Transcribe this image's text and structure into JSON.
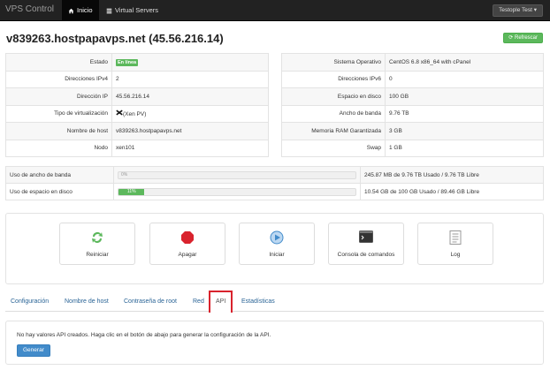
{
  "navbar": {
    "brand": "VPS Control",
    "items": [
      {
        "label": "Inicio",
        "icon": "home-icon"
      },
      {
        "label": "Virtual Servers",
        "icon": "list-icon"
      }
    ],
    "user_label": "Testople Test ▾"
  },
  "header": {
    "title": "v839263.hostpapavps.net (45.56.216.14)",
    "refresh_label": "Refrescar"
  },
  "info_left": [
    {
      "label": "Estado",
      "value": "En línea"
    },
    {
      "label": "Direcciones IPv4",
      "value": "2"
    },
    {
      "label": "Dirección IP",
      "value": "45.56.216.14"
    },
    {
      "label": "Tipo de virtualización",
      "value": "(Xen PV)"
    },
    {
      "label": "Nombre de host",
      "value": "v839263.hostpapavps.net"
    },
    {
      "label": "Nodo",
      "value": "xen101"
    }
  ],
  "info_right": [
    {
      "label": "Sistema Operativo",
      "value": "CentOS 6.8 x86_64 with cPanel"
    },
    {
      "label": "Direcciones IPv6",
      "value": "0"
    },
    {
      "label": "Espacio en disco",
      "value": "100 GB"
    },
    {
      "label": "Ancho de banda",
      "value": "9.76 TB"
    },
    {
      "label": "Memoria RAM Garantizada",
      "value": "3 GB"
    },
    {
      "label": "Swap",
      "value": "1 GB"
    }
  ],
  "usage": [
    {
      "label": "Uso de ancho de banda",
      "percent": 0,
      "bar_text": "0%",
      "detail": "245.87 MB de 9.76 TB Usado / 9.76 TB Libre"
    },
    {
      "label": "Uso de espacio en disco",
      "percent": 11,
      "bar_text": "11%",
      "detail": "10.54 GB de 100 GB Usado / 89.46 GB Libre"
    }
  ],
  "actions": [
    {
      "label": "Reiniciar",
      "icon": "refresh-icon"
    },
    {
      "label": "Apagar",
      "icon": "stop-icon"
    },
    {
      "label": "Iniciar",
      "icon": "play-icon"
    },
    {
      "label": "Consola de comandos",
      "icon": "terminal-icon"
    },
    {
      "label": "Log",
      "icon": "log-icon"
    }
  ],
  "tabs": [
    {
      "label": "Configuración"
    },
    {
      "label": "Nombre de host"
    },
    {
      "label": "Contraseña de root"
    },
    {
      "label": "Red"
    },
    {
      "label": "API"
    },
    {
      "label": "Estadísticas"
    }
  ],
  "api": {
    "message": "No hay valores API creados. Haga clic en el botón de abajo para generar la configuración de la API.",
    "generate_label": "Generar"
  },
  "colors": {
    "navbar": "#222222",
    "success": "#5cb85c",
    "primary": "#428bca",
    "highlight": "#d9232d"
  }
}
